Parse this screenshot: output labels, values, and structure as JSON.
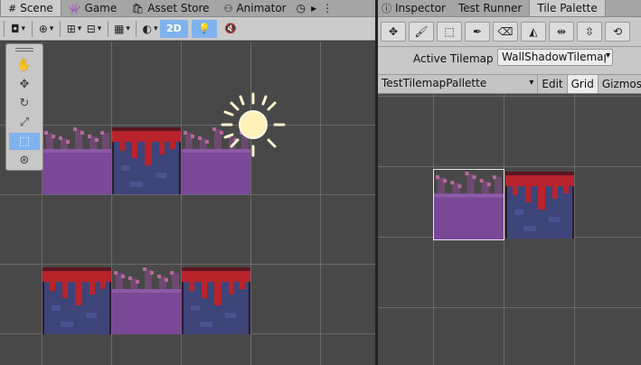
{
  "scene_tabs": [
    {
      "label": "Scene",
      "icon": "#",
      "icon_name": "grid-hash-icon",
      "active": true
    },
    {
      "label": "Game",
      "icon": "👾",
      "icon_name": "gamepad-icon",
      "active": false
    },
    {
      "label": "Asset Store",
      "icon": "🛍",
      "icon_name": "store-bag-icon",
      "active": false
    },
    {
      "label": "Animator",
      "icon": "⚇",
      "icon_name": "animator-icon",
      "active": false
    }
  ],
  "scene_tab_extras": {
    "clock_icon": "◷",
    "next_icon": "▸",
    "more_icon": "⋮"
  },
  "right_tabs": [
    {
      "label": "Inspector",
      "icon": "ⓘ",
      "icon_name": "info-icon",
      "active": false
    },
    {
      "label": "Test Runner",
      "icon": "",
      "icon_name": "",
      "active": false
    },
    {
      "label": "Tile Palette",
      "icon": "",
      "icon_name": "",
      "active": true
    }
  ],
  "toolbar": {
    "draw_mode_icon": "◘",
    "gizmo_global_icon": "⊕",
    "snap_icon": "⊞",
    "grid_snap_icon": "⊟",
    "increment_icon": "▦",
    "shading_icon": "◐",
    "mode_2d": "2D",
    "light_icon": "💡",
    "audio_icon": "🔇"
  },
  "scene_tools": [
    {
      "name": "hand-tool",
      "glyph": "✋",
      "active": false
    },
    {
      "name": "move-tool",
      "glyph": "✥",
      "active": false
    },
    {
      "name": "rotate-tool",
      "glyph": "↻",
      "active": false
    },
    {
      "name": "scale-tool",
      "glyph": "⤢",
      "active": false
    },
    {
      "name": "rect-tool",
      "glyph": "⬚",
      "active": true
    },
    {
      "name": "transform-tool",
      "glyph": "⊛",
      "active": false
    }
  ],
  "tile_palette": {
    "paint_tools": [
      {
        "name": "select-tool",
        "glyph": "✥"
      },
      {
        "name": "brush-tool",
        "glyph": "🖌"
      },
      {
        "name": "box-fill-tool",
        "glyph": "⬚"
      },
      {
        "name": "picker-tool",
        "glyph": "✒"
      },
      {
        "name": "eraser-tool",
        "glyph": "⌫"
      },
      {
        "name": "fill-bucket-tool",
        "glyph": "◭"
      },
      {
        "name": "flip-x-tool",
        "glyph": "⇹"
      },
      {
        "name": "flip-y-tool",
        "glyph": "⇳"
      },
      {
        "name": "rotate-tile-tool",
        "glyph": "⟲"
      }
    ],
    "active_tilemap_label": "Active Tilemap",
    "active_tilemap_value": "WallShadowTilemap",
    "palette_value": "TestTilemapPallette",
    "edit_label": "Edit",
    "grid_label": "Grid",
    "gizmos_label": "Gizmos"
  },
  "colors": {
    "purple_tile": "#7b4898",
    "wall_blue": "#3d4478",
    "wall_red": "#b8232c",
    "accent_blue": "#7fb2ee",
    "scene_bg": "#484848"
  }
}
